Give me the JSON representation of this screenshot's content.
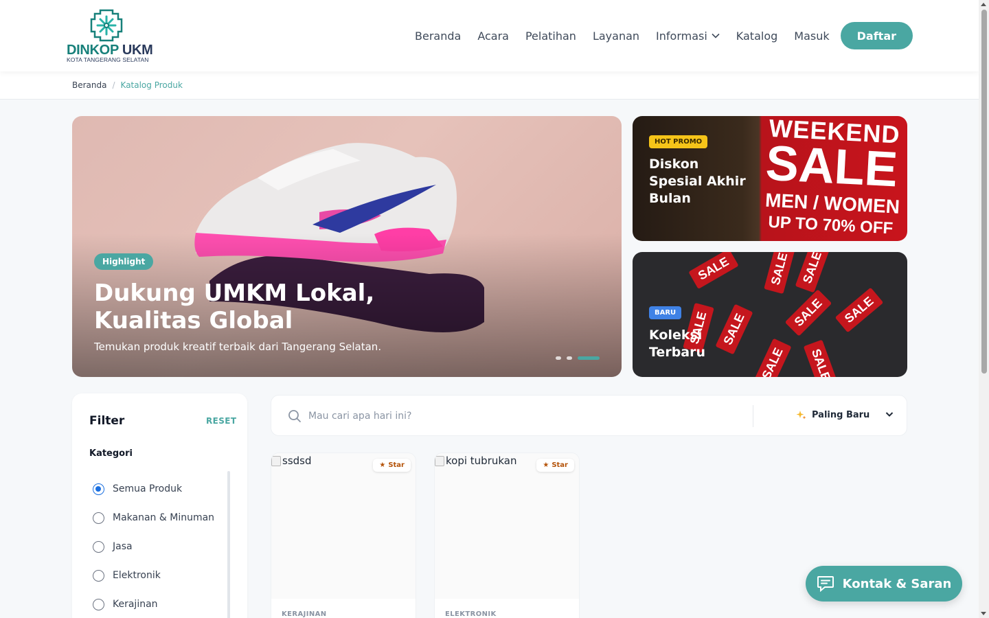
{
  "logo": {
    "name_main": "DINKOP",
    "name_accent": "UKM",
    "subtitle": "KOTA TANGERANG SELATAN"
  },
  "nav": {
    "items": [
      "Beranda",
      "Acara",
      "Pelatihan",
      "Layanan",
      "Informasi",
      "Katalog",
      "Masuk"
    ],
    "register_label": "Daftar"
  },
  "breadcrumb": {
    "home": "Beranda",
    "separator": "/",
    "current": "Katalog Produk"
  },
  "hero": {
    "badge": "Highlight",
    "title": "Dukung UMKM Lokal, Kualitas Global",
    "subtitle": "Temukan produk kreatif terbaik dari Tangerang Selatan.",
    "slide_count": 3,
    "active_slide": 3
  },
  "promos": [
    {
      "badge": "HOT PROMO",
      "title": "Diskon Spesial Akhir Bulan",
      "image_text": [
        "WEEKEND",
        "SALE",
        "MEN / WOMEN",
        "UP TO 70% OFF"
      ]
    },
    {
      "badge": "BARU",
      "title": "Koleksi Terbaru",
      "image_text": "SALE"
    }
  ],
  "filter": {
    "title": "Filter",
    "reset_label": "RESET",
    "category_label": "Kategori",
    "categories": [
      {
        "label": "Semua Produk",
        "checked": true
      },
      {
        "label": "Makanan & Minuman",
        "checked": false
      },
      {
        "label": "Jasa",
        "checked": false
      },
      {
        "label": "Elektronik",
        "checked": false
      },
      {
        "label": "Kerajinan",
        "checked": false
      }
    ]
  },
  "search": {
    "placeholder": "Mau cari apa hari ini?",
    "sort_value": "Paling Baru"
  },
  "products": [
    {
      "image_alt": "ssdsd",
      "badge": "Star",
      "category": "KERAJINAN"
    },
    {
      "image_alt": "kopi tubrukan",
      "badge": "Star",
      "category": "ELEKTRONIK"
    }
  ],
  "contact_button": {
    "label": "Kontak & Saran"
  },
  "colors": {
    "primary": "#4aa7a2",
    "promo_badge_hot": "#f6c419",
    "promo_badge_new": "#3f82e6",
    "star": "#b45309"
  }
}
